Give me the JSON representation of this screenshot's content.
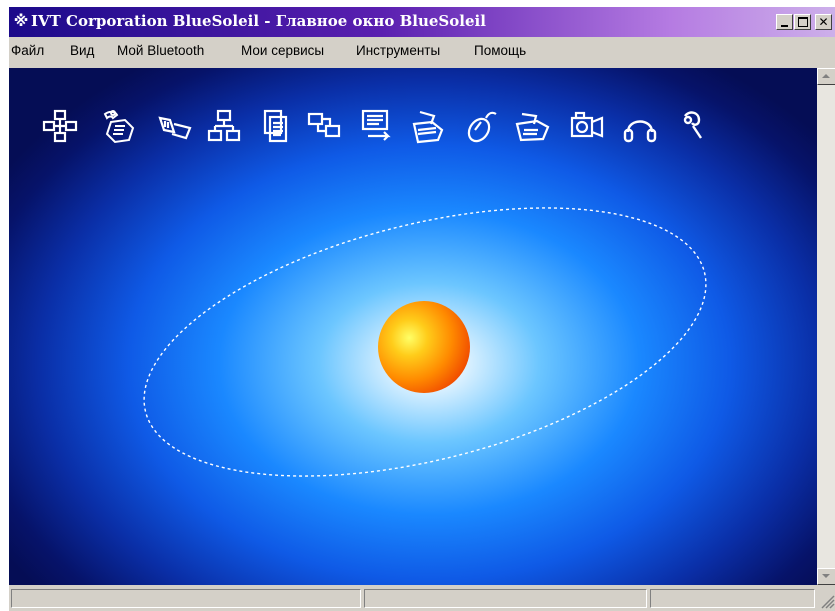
{
  "window": {
    "title": "IVT Corporation BlueSoleil - Главное окно BlueSoleil",
    "title_icon": "bluetooth-icon",
    "controls": [
      "minimize-icon",
      "maximize-icon",
      "close-icon"
    ]
  },
  "menu": {
    "file": "Файл",
    "view": "Вид",
    "my_bluetooth": "Мой Bluetooth",
    "my_services": "Мои сервисы",
    "tools": "Инструменты",
    "help": "Помощь"
  },
  "services": [
    "personal-area-network-icon",
    "dial-up-networking-icon",
    "serial-port-icon",
    "lan-access-icon",
    "file-transfer-icon",
    "synchronization-icon",
    "object-push-icon",
    "printer-icon",
    "mouse-icon",
    "fax-icon",
    "basic-imaging-icon",
    "headphones-icon",
    "headset-icon"
  ],
  "colors": {
    "title_start": "#1b0a8a",
    "title_end": "#cdb0ea",
    "client_bg_outer": "#050d55",
    "client_bg_inner": "#ffffff",
    "orbit": "#ffffff",
    "local_device": "#ff8a00"
  },
  "status": {
    "cell1": "",
    "cell2": "",
    "cell3": ""
  }
}
